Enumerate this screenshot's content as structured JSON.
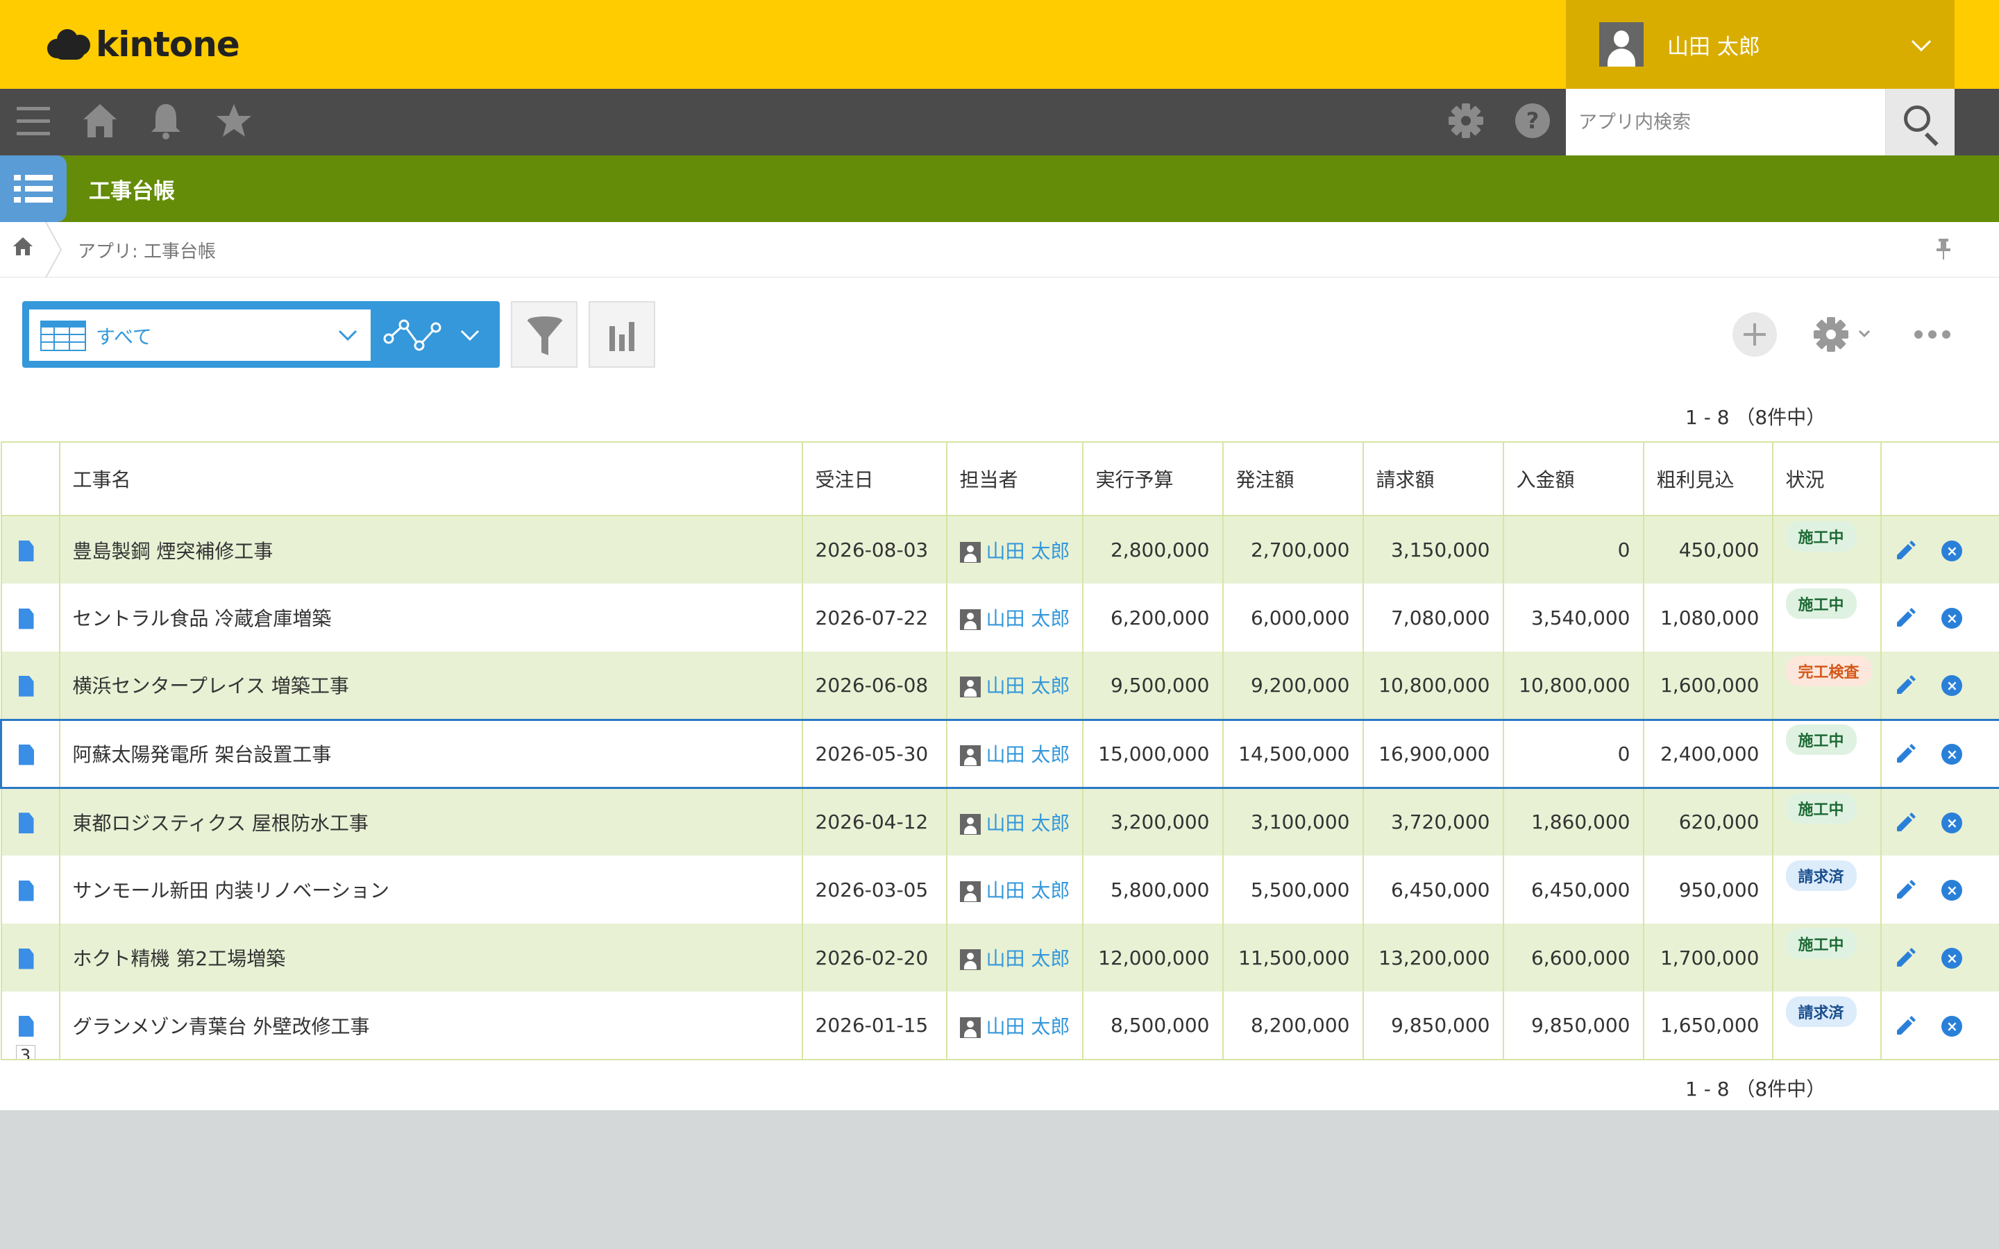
{
  "brand": {
    "logo_text": "kintone"
  },
  "user": {
    "name": "山田 太郎"
  },
  "search": {
    "placeholder": "アプリ内検索"
  },
  "app": {
    "title": "工事台帳"
  },
  "breadcrumb": {
    "text": "アプリ: 工事台帳"
  },
  "view": {
    "name": "すべて"
  },
  "pager": {
    "top": "1 - 8 （8件中）",
    "bottom": "1 - 8 （8件中）"
  },
  "colors": {
    "header": "#ffcc00",
    "nav": "#4b4b4b",
    "app_bar": "#648c08",
    "accent": "#3498db",
    "row_alt": "#e8f1d4"
  },
  "table": {
    "columns": [
      "工事名",
      "受注日",
      "担当者",
      "実行予算",
      "発注額",
      "請求額",
      "入金額",
      "粗利見込",
      "状況"
    ],
    "rows": [
      {
        "name": "豊島製鋼 煙突補修工事",
        "date": "2026-08-03",
        "person": "山田 太郎",
        "budget": "2,800,000",
        "order": "2,700,000",
        "invoice": "3,150,000",
        "paid": "0",
        "profit": "450,000",
        "status": "施工中",
        "status_color": "green"
      },
      {
        "name": "セントラル食品 冷蔵倉庫増築",
        "date": "2026-07-22",
        "person": "山田 太郎",
        "budget": "6,200,000",
        "order": "6,000,000",
        "invoice": "7,080,000",
        "paid": "3,540,000",
        "profit": "1,080,000",
        "status": "施工中",
        "status_color": "green"
      },
      {
        "name": "横浜センタープレイス 増築工事",
        "date": "2026-06-08",
        "person": "山田 太郎",
        "budget": "9,500,000",
        "order": "9,200,000",
        "invoice": "10,800,000",
        "paid": "10,800,000",
        "profit": "1,600,000",
        "status": "完工検査",
        "status_color": "orange"
      },
      {
        "name": "阿蘇太陽発電所 架台設置工事",
        "date": "2026-05-30",
        "person": "山田 太郎",
        "budget": "15,000,000",
        "order": "14,500,000",
        "invoice": "16,900,000",
        "paid": "0",
        "profit": "2,400,000",
        "status": "施工中",
        "status_color": "green"
      },
      {
        "name": "東都ロジスティクス 屋根防水工事",
        "date": "2026-04-12",
        "person": "山田 太郎",
        "budget": "3,200,000",
        "order": "3,100,000",
        "invoice": "3,720,000",
        "paid": "1,860,000",
        "profit": "620,000",
        "status": "施工中",
        "status_color": "green"
      },
      {
        "name": "サンモール新田 内装リノベーション",
        "date": "2026-03-05",
        "person": "山田 太郎",
        "budget": "5,800,000",
        "order": "5,500,000",
        "invoice": "6,450,000",
        "paid": "6,450,000",
        "profit": "950,000",
        "status": "請求済",
        "status_color": "blue"
      },
      {
        "name": "ホクト精機 第2工場増築",
        "date": "2026-02-20",
        "person": "山田 太郎",
        "budget": "12,000,000",
        "order": "11,500,000",
        "invoice": "13,200,000",
        "paid": "6,600,000",
        "profit": "1,700,000",
        "status": "施工中",
        "status_color": "green"
      },
      {
        "name": "グランメゾン青葉台 外壁改修工事",
        "date": "2026-01-15",
        "person": "山田 太郎",
        "budget": "8,500,000",
        "order": "8,200,000",
        "invoice": "9,850,000",
        "paid": "9,850,000",
        "profit": "1,650,000",
        "status": "請求済",
        "status_color": "blue",
        "comments": "3"
      }
    ]
  }
}
